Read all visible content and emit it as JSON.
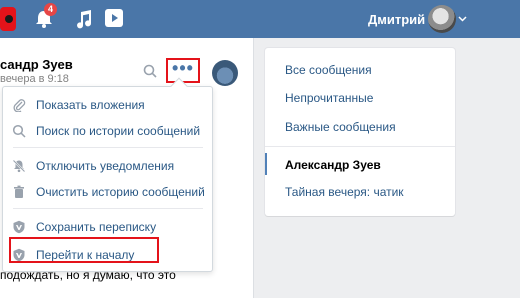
{
  "topbar": {
    "notifications_count": "4",
    "username": "Дмитрий"
  },
  "chat": {
    "contact_name": "сандр Зуев",
    "status": "вечера в 9:18",
    "bottom_text": "подождать, но я думаю, что это"
  },
  "menu": {
    "items": [
      {
        "label": "Показать вложения",
        "icon": "paperclip-icon"
      },
      {
        "label": "Поиск по истории сообщений",
        "icon": "search-icon"
      },
      {
        "label": "Отключить уведомления",
        "icon": "mute-icon"
      },
      {
        "label": "Очистить историю сообщений",
        "icon": "trash-icon"
      },
      {
        "label": "Сохранить переписку",
        "icon": "vk-shield-icon"
      },
      {
        "label": "Перейти к началу",
        "icon": "vk-shield-icon"
      }
    ]
  },
  "filters": {
    "items": [
      "Все сообщения",
      "Непрочитанные",
      "Важные сообщения"
    ],
    "active_chat": "Александр Зуев",
    "other_chat": "Тайная вечеря: чатик"
  },
  "colors": {
    "topbar": "#4a76a8",
    "link": "#2a5885",
    "highlight": "#e4131a",
    "badge": "#e64646"
  }
}
